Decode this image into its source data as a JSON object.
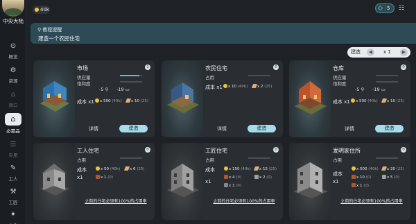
{
  "app": {
    "region": "中央大陆"
  },
  "topbar": {
    "coins": "40k",
    "gems": "5"
  },
  "sidebar": {
    "items": [
      {
        "label": "概览",
        "icon": "⊙"
      },
      {
        "label": "资源",
        "icon": "⚙"
      },
      {
        "label": "商口",
        "icon": "⌂"
      },
      {
        "label": "必需品",
        "icon": "⌂"
      },
      {
        "label": "实用",
        "icon": "☰"
      },
      {
        "label": "工人",
        "icon": "✎"
      },
      {
        "label": "工匠",
        "icon": "⚒"
      },
      {
        "label": "文化",
        "icon": "✦"
      }
    ]
  },
  "banner": {
    "title": "教程提醒",
    "text": "建造一个农民住宅"
  },
  "build_control": {
    "label": "建造",
    "qty": "x 1"
  },
  "cards": [
    {
      "name": "市场",
      "badge": "1",
      "supply": "供应量",
      "satisfy": "饱和度",
      "effect_a": "-5",
      "effect_b": "-19",
      "cost": "成本 x1",
      "res1": "x 500",
      "res1b": "(40k)",
      "res2": "x 10",
      "res2b": "(25)",
      "details": "详情",
      "build": "建造"
    },
    {
      "name": "农民住宅",
      "badge": "0",
      "occupy": "占用",
      "cost": "成本 x1",
      "res1": "x 10",
      "res1b": "(40k)",
      "res2": "x 2",
      "res2b": "(25)",
      "details": "详情",
      "build": "建造"
    },
    {
      "name": "仓库",
      "badge": "0",
      "supply": "供应量",
      "satisfy": "饱和度",
      "effect_a": "-5",
      "effect_b": "-19",
      "cost": "成本 x1",
      "res1": "x 500",
      "res1b": "(40k)",
      "res2": "x 10",
      "res2b": "(25)",
      "details": "详情",
      "build": "建造"
    },
    {
      "name": "工人住宅",
      "badge": "0",
      "occupy": "占用",
      "cost": "成本",
      "x1": "x1",
      "res1": "x 50",
      "res1b": "(40k)",
      "res2": "x 6",
      "res2b": "(25)",
      "res3": "x 1",
      "res3b": "(0)",
      "warn": "之前的住宅必须有100%的占用率"
    },
    {
      "name": "工匠住宅",
      "badge": "0",
      "occupy": "占用",
      "cost": "成本",
      "x1": "x1",
      "res1": "x 150",
      "res1b": "(40k)",
      "res2": "x 15",
      "res2b": "(25)",
      "res3": "x 4",
      "res3b": "(0)",
      "res4": "x 2",
      "res4b": "(0)",
      "res5": "x 1",
      "res5b": "(0)",
      "warn": "之前的住宅必须有100%的占用率"
    },
    {
      "name": "发明家住所",
      "badge": "0",
      "occupy": "占用",
      "cost": "成本",
      "x1": "x1",
      "res1": "x 500",
      "res1b": "(40k)",
      "res2": "x 20",
      "res2b": "(25)",
      "res3": "x 10",
      "res3b": "(0)",
      "res4": "x 5",
      "res4b": "(0)",
      "res5": "x 1",
      "res5b": "(0)",
      "warn": "之前的住宅必须有100%的占用率"
    }
  ]
}
